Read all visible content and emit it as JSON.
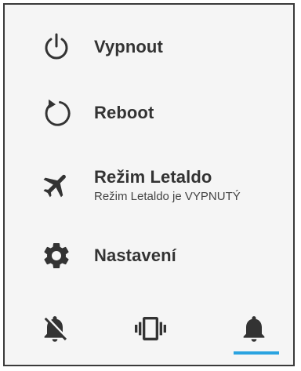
{
  "menu": {
    "power_off": {
      "label": "Vypnout",
      "icon": "power-icon"
    },
    "reboot": {
      "label": "Reboot",
      "icon": "restart-icon"
    },
    "airplane": {
      "label": "Režim Letaldo",
      "status": "Režim Letaldo je VYPNUTÝ",
      "icon": "airplane-icon"
    },
    "settings": {
      "label": "Nastavení",
      "icon": "gear-icon"
    }
  },
  "sound_modes": {
    "options": [
      "silent",
      "vibrate",
      "sound"
    ],
    "selected": "sound",
    "selected_indicator_color": "#2aa3e0"
  },
  "colors": {
    "icon": "#333333",
    "background": "#f5f5f5",
    "border": "#3a3a3a"
  }
}
